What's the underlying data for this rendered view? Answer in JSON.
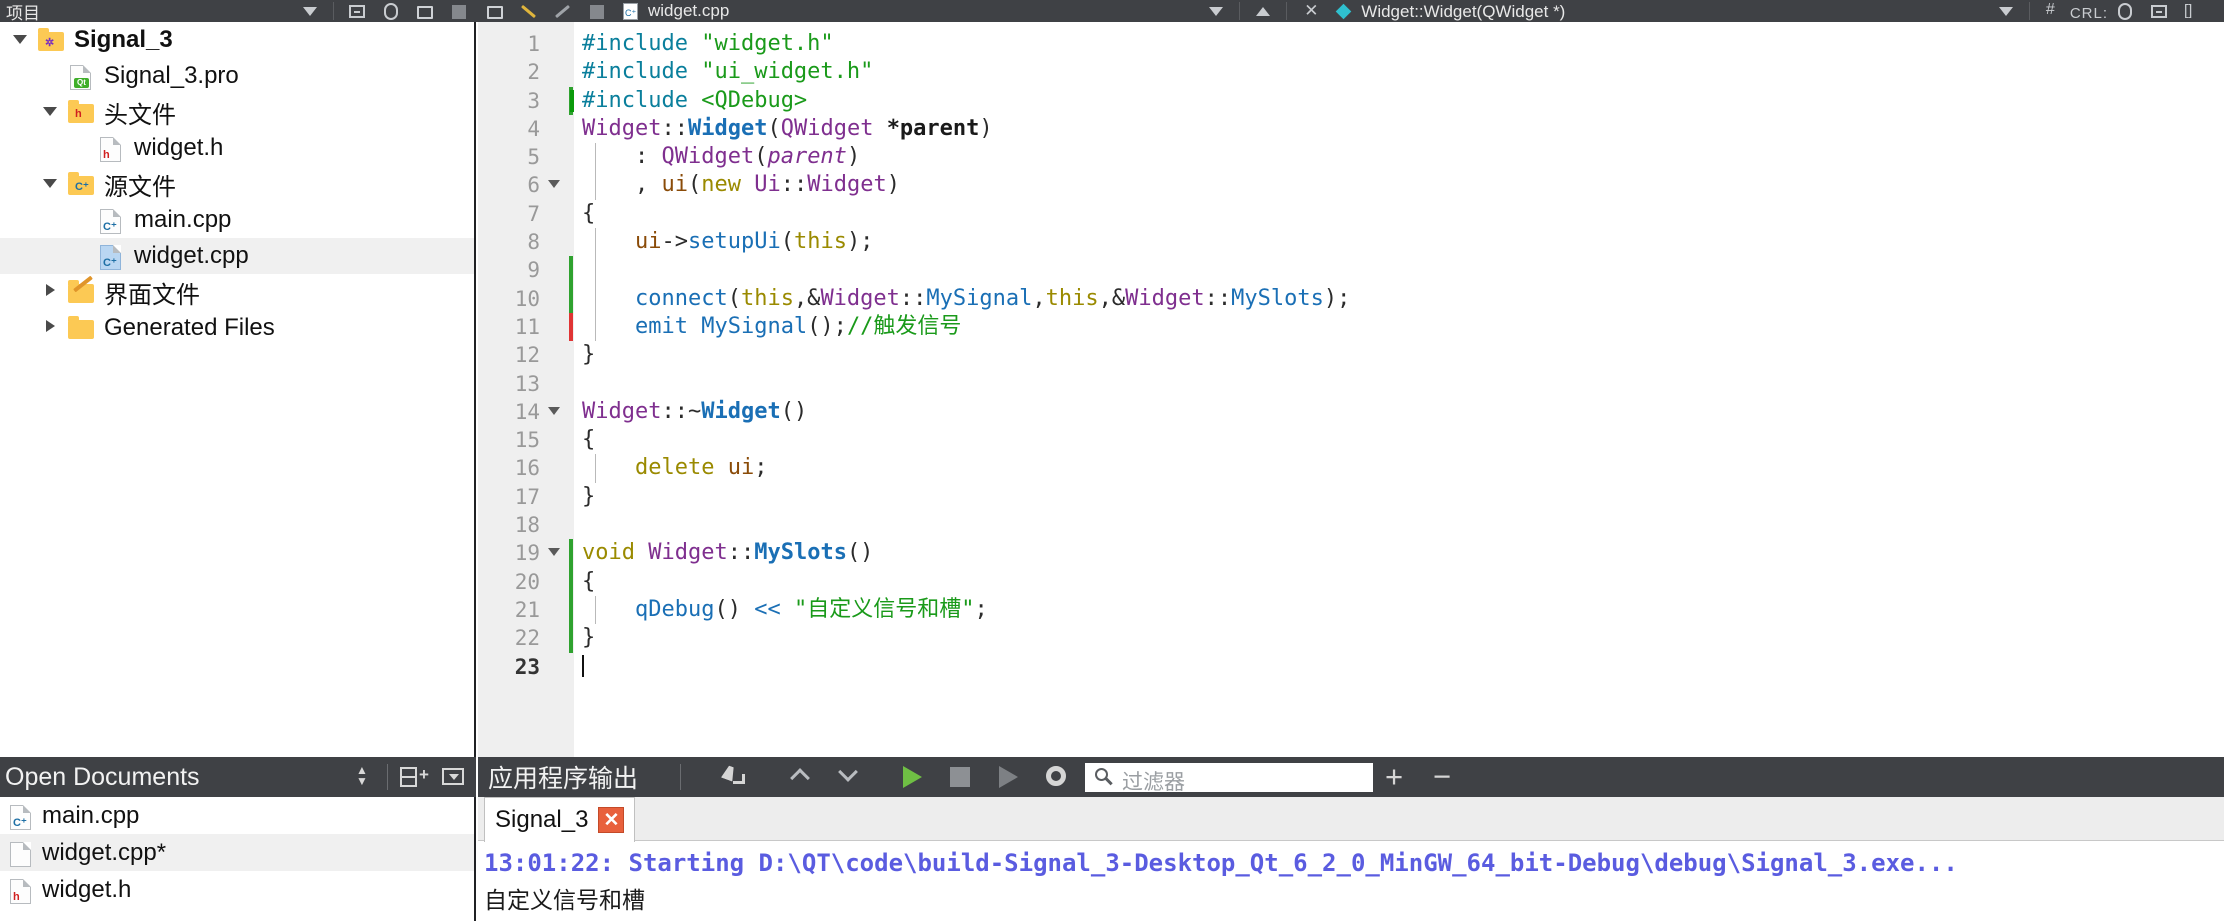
{
  "topbar": {
    "project_label": "项目",
    "current_file_tab": "widget.cpp",
    "symbol_dropdown": "Widget::Widget(QWidget *)",
    "ctrl_label": "CRL:",
    "icons": [
      "save-icon",
      "pencil-icon",
      "undo-icon",
      "redo-icon",
      "file-cpp-icon",
      "chevron-down-icon",
      "caret-up-icon",
      "close-icon",
      "diamond-icon",
      "hash-icon",
      "circle-icon",
      "minibox-icon",
      "brace-icon"
    ]
  },
  "project_tree": {
    "items": [
      {
        "label": "Signal_3",
        "icon": "folder-project-icon",
        "indent": 0,
        "expander": "down",
        "bold": true,
        "selected": false
      },
      {
        "label": "Signal_3.pro",
        "icon": "file-qt-icon",
        "indent": 1,
        "expander": "none",
        "bold": false,
        "selected": false
      },
      {
        "label": "头文件",
        "icon": "folder-h-icon",
        "indent": 1,
        "expander": "down",
        "bold": false,
        "selected": false
      },
      {
        "label": "widget.h",
        "icon": "file-h-icon",
        "indent": 2,
        "expander": "none",
        "bold": false,
        "selected": false
      },
      {
        "label": "源文件",
        "icon": "folder-cpp-icon",
        "indent": 1,
        "expander": "down",
        "bold": false,
        "selected": false
      },
      {
        "label": "main.cpp",
        "icon": "file-cpp-icon",
        "indent": 2,
        "expander": "none",
        "bold": false,
        "selected": false
      },
      {
        "label": "widget.cpp",
        "icon": "file-cpp-blue-icon",
        "indent": 2,
        "expander": "none",
        "bold": false,
        "selected": true
      },
      {
        "label": "界面文件",
        "icon": "folder-ui-icon",
        "indent": 1,
        "expander": "right",
        "bold": false,
        "selected": false
      },
      {
        "label": "Generated Files",
        "icon": "folder-plain-icon",
        "indent": 1,
        "expander": "right",
        "bold": false,
        "selected": false
      }
    ]
  },
  "editor": {
    "lines": [
      {
        "n": "1",
        "fold": false,
        "change": "",
        "tokens": [
          {
            "t": "#include",
            "c": "s-pre"
          },
          {
            "t": " ",
            "c": "s-plain"
          },
          {
            "t": "\"widget.h\"",
            "c": "s-str"
          }
        ]
      },
      {
        "n": "2",
        "fold": false,
        "change": "",
        "tokens": [
          {
            "t": "#include",
            "c": "s-pre"
          },
          {
            "t": " ",
            "c": "s-plain"
          },
          {
            "t": "\"ui_widget.h\"",
            "c": "s-str"
          }
        ]
      },
      {
        "n": "3",
        "fold": false,
        "change": "green",
        "tokens": [
          {
            "t": "#include",
            "c": "s-pre"
          },
          {
            "t": " ",
            "c": "s-plain"
          },
          {
            "t": "<QDebug>",
            "c": "s-str"
          }
        ]
      },
      {
        "n": "4",
        "fold": false,
        "change": "",
        "tokens": [
          {
            "t": "Widget",
            "c": "s-cls"
          },
          {
            "t": "::",
            "c": "s-op"
          },
          {
            "t": "Widget",
            "c": "s-fn"
          },
          {
            "t": "(",
            "c": "s-op"
          },
          {
            "t": "QWidget",
            "c": "s-cls"
          },
          {
            "t": " ",
            "c": "s-plain"
          },
          {
            "t": "*parent",
            "c": "s-bold s-plain"
          },
          {
            "t": ")",
            "c": "s-op"
          }
        ]
      },
      {
        "n": "5",
        "fold": false,
        "change": "",
        "indent": [
          1
        ],
        "tokens": [
          {
            "t": "    : ",
            "c": "s-op"
          },
          {
            "t": "QWidget",
            "c": "s-cls"
          },
          {
            "t": "(",
            "c": "s-op"
          },
          {
            "t": "parent",
            "c": "s-par"
          },
          {
            "t": ")",
            "c": "s-op"
          }
        ]
      },
      {
        "n": "6",
        "fold": true,
        "change": "",
        "indent": [
          1
        ],
        "tokens": [
          {
            "t": "    , ",
            "c": "s-op"
          },
          {
            "t": "ui",
            "c": "s-var"
          },
          {
            "t": "(",
            "c": "s-op"
          },
          {
            "t": "new",
            "c": "s-kw"
          },
          {
            "t": " ",
            "c": "s-plain"
          },
          {
            "t": "Ui",
            "c": "s-cls"
          },
          {
            "t": "::",
            "c": "s-op"
          },
          {
            "t": "Widget",
            "c": "s-cls"
          },
          {
            "t": ")",
            "c": "s-op"
          }
        ]
      },
      {
        "n": "7",
        "fold": false,
        "change": "",
        "tokens": [
          {
            "t": "{",
            "c": "s-op"
          }
        ]
      },
      {
        "n": "8",
        "fold": false,
        "change": "",
        "indent": [
          1
        ],
        "tokens": [
          {
            "t": "    ",
            "c": "s-plain"
          },
          {
            "t": "ui",
            "c": "s-var"
          },
          {
            "t": "->",
            "c": "s-op"
          },
          {
            "t": "setupUi",
            "c": "s-fn2"
          },
          {
            "t": "(",
            "c": "s-op"
          },
          {
            "t": "this",
            "c": "s-kw"
          },
          {
            "t": ");",
            "c": "s-op"
          }
        ]
      },
      {
        "n": "9",
        "fold": false,
        "change": "green",
        "indent": [
          1
        ],
        "tokens": []
      },
      {
        "n": "10",
        "fold": false,
        "change": "green",
        "indent": [
          1
        ],
        "tokens": [
          {
            "t": "    ",
            "c": "s-plain"
          },
          {
            "t": "connect",
            "c": "s-fn2"
          },
          {
            "t": "(",
            "c": "s-op"
          },
          {
            "t": "this",
            "c": "s-kw"
          },
          {
            "t": ",&",
            "c": "s-op"
          },
          {
            "t": "Widget",
            "c": "s-cls"
          },
          {
            "t": "::",
            "c": "s-op"
          },
          {
            "t": "MySignal",
            "c": "s-fn2"
          },
          {
            "t": ",",
            "c": "s-op"
          },
          {
            "t": "this",
            "c": "s-kw"
          },
          {
            "t": ",&",
            "c": "s-op"
          },
          {
            "t": "Widget",
            "c": "s-cls"
          },
          {
            "t": "::",
            "c": "s-op"
          },
          {
            "t": "MySlots",
            "c": "s-fn2"
          },
          {
            "t": ");",
            "c": "s-op"
          }
        ]
      },
      {
        "n": "11",
        "fold": false,
        "change": "red",
        "indent": [
          1
        ],
        "tokens": [
          {
            "t": "    ",
            "c": "s-plain"
          },
          {
            "t": "emit",
            "c": "s-fn2"
          },
          {
            "t": " ",
            "c": "s-plain"
          },
          {
            "t": "MySignal",
            "c": "s-fn2"
          },
          {
            "t": "();",
            "c": "s-op"
          },
          {
            "t": "//触发信号",
            "c": "s-cmt"
          }
        ]
      },
      {
        "n": "12",
        "fold": false,
        "change": "",
        "tokens": [
          {
            "t": "}",
            "c": "s-op"
          }
        ]
      },
      {
        "n": "13",
        "fold": false,
        "change": "",
        "tokens": []
      },
      {
        "n": "14",
        "fold": true,
        "change": "",
        "tokens": [
          {
            "t": "Widget",
            "c": "s-cls"
          },
          {
            "t": "::~",
            "c": "s-op"
          },
          {
            "t": "Widget",
            "c": "s-fn"
          },
          {
            "t": "()",
            "c": "s-op"
          }
        ]
      },
      {
        "n": "15",
        "fold": false,
        "change": "",
        "tokens": [
          {
            "t": "{",
            "c": "s-op"
          }
        ]
      },
      {
        "n": "16",
        "fold": false,
        "change": "",
        "indent": [
          1
        ],
        "tokens": [
          {
            "t": "    ",
            "c": "s-plain"
          },
          {
            "t": "delete",
            "c": "s-kw"
          },
          {
            "t": " ",
            "c": "s-plain"
          },
          {
            "t": "ui",
            "c": "s-var"
          },
          {
            "t": ";",
            "c": "s-op"
          }
        ]
      },
      {
        "n": "17",
        "fold": false,
        "change": "",
        "tokens": [
          {
            "t": "}",
            "c": "s-op"
          }
        ]
      },
      {
        "n": "18",
        "fold": false,
        "change": "",
        "tokens": []
      },
      {
        "n": "19",
        "fold": true,
        "change": "green",
        "tokens": [
          {
            "t": "void",
            "c": "s-void"
          },
          {
            "t": " ",
            "c": "s-plain"
          },
          {
            "t": "Widget",
            "c": "s-cls"
          },
          {
            "t": "::",
            "c": "s-op"
          },
          {
            "t": "MySlots",
            "c": "s-fn"
          },
          {
            "t": "()",
            "c": "s-op"
          }
        ]
      },
      {
        "n": "20",
        "fold": false,
        "change": "green",
        "tokens": [
          {
            "t": "{",
            "c": "s-op"
          }
        ]
      },
      {
        "n": "21",
        "fold": false,
        "change": "green",
        "indent": [
          1
        ],
        "tokens": [
          {
            "t": "    ",
            "c": "s-plain"
          },
          {
            "t": "qDebug",
            "c": "s-qd"
          },
          {
            "t": "() ",
            "c": "s-op"
          },
          {
            "t": "<<",
            "c": "s-qd"
          },
          {
            "t": " ",
            "c": "s-plain"
          },
          {
            "t": "\"自定义信号和槽\"",
            "c": "s-str"
          },
          {
            "t": ";",
            "c": "s-op"
          }
        ]
      },
      {
        "n": "22",
        "fold": false,
        "change": "green",
        "tokens": [
          {
            "t": "}",
            "c": "s-op"
          }
        ]
      },
      {
        "n": "23",
        "fold": false,
        "change": "",
        "current": true,
        "caret": true,
        "tokens": []
      }
    ]
  },
  "open_documents": {
    "title": "Open Documents",
    "buttons": [
      "sort-updown-icon",
      "split-add-icon",
      "dropdown-menu-icon"
    ],
    "items": [
      {
        "label": "main.cpp",
        "icon": "file-cpp-icon",
        "selected": false
      },
      {
        "label": "widget.cpp*",
        "icon": "file-plain-icon",
        "selected": true
      },
      {
        "label": "widget.h",
        "icon": "file-h-icon",
        "selected": false
      }
    ]
  },
  "output_pane": {
    "title": "应用程序输出",
    "toolbar_icons": [
      "clear-broom-icon",
      "chevron-up-icon",
      "chevron-down-icon",
      "run-play-icon",
      "stop-square-icon",
      "rerun-play-icon",
      "gear-icon",
      "plus-icon",
      "minus-icon"
    ],
    "filter": {
      "placeholder": "过滤器",
      "value": "",
      "icon": "search-icon"
    },
    "tab": {
      "label": "Signal_3",
      "close_icon": "close-tab-icon"
    },
    "lines": [
      "13:01:22: Starting D:\\QT\\code\\build-Signal_3-Desktop_Qt_6_2_0_MinGW_64_bit-Debug\\debug\\Signal_3.exe...",
      "自定义信号和槽"
    ]
  },
  "colors": {
    "chrome_dark": "#3f4145",
    "selection_gray": "#f0f0f0",
    "change_green": "#2fa22f",
    "change_red": "#e03434",
    "output_blue": "#5a5ce0",
    "tab_close_orange": "#e8603c",
    "run_green": "#6fbf44",
    "folder_yellow": "#fcc954"
  }
}
